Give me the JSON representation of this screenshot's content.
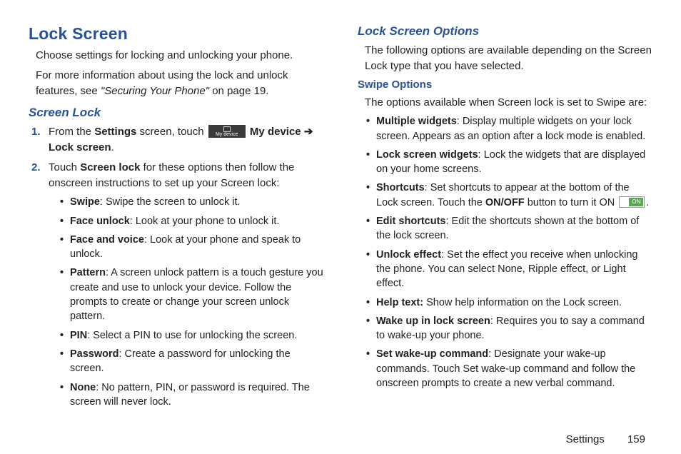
{
  "left": {
    "title": "Lock Screen",
    "p1": "Choose settings for locking and unlocking your phone.",
    "p2a": "For more information about using the lock and unlock features, see ",
    "p2_em": "\"Securing Your Phone\"",
    "p2b": " on page 19.",
    "subhead": "Screen Lock",
    "step1_a": "From the ",
    "step1_b": "Settings",
    "step1_c": " screen, touch ",
    "step1_icon_label": "My device",
    "step1_d": " My device ",
    "step1_arrow": "➔",
    "step1_e": " Lock screen",
    "step1_f": ".",
    "step2_a": "Touch ",
    "step2_b": "Screen lock",
    "step2_c": " for these options then follow the onscreen instructions to set up your Screen lock:",
    "b1t": "Swipe",
    "b1d": ": Swipe the screen to unlock it.",
    "b2t": "Face unlock",
    "b2d": ": Look at your phone to unlock it.",
    "b3t": "Face and voice",
    "b3d": ": Look at your phone and speak to unlock.",
    "b4t": "Pattern",
    "b4d": ": A screen unlock pattern is a touch gesture you create and use to unlock your device. Follow the prompts to create or change your screen unlock pattern.",
    "b5t": "PIN",
    "b5d": ": Select a PIN to use for unlocking the screen.",
    "b6t": "Password",
    "b6d": ": Create a password for unlocking the screen.",
    "b7t": "None",
    "b7d": ": No pattern, PIN, or password is required. The screen will never lock."
  },
  "right": {
    "title": "Lock Screen Options",
    "intro": "The following options are available depending on the Screen Lock type that you have selected.",
    "opthead": "Swipe Options",
    "optintro": "The options available when Screen lock is set to Swipe are:",
    "r1t": "Multiple widgets",
    "r1d": ": Display multiple widgets on your lock screen. Appears as an option after a lock mode is enabled.",
    "r2t": "Lock screen widgets",
    "r2d": ": Lock the widgets that are displayed on your home screens.",
    "r3t": "Shortcuts",
    "r3a": ": Set shortcuts to appear at the bottom of the Lock screen. Touch the ",
    "r3b": "ON/OFF",
    "r3c": " button to turn it ON ",
    "r3d": ".",
    "r4t": "Edit shortcuts",
    "r4d": ": Edit the shortcuts shown at the bottom of the lock screen.",
    "r5t": "Unlock effect",
    "r5d": ": Set the effect you receive when unlocking the phone. You can select None, Ripple effect, or Light effect.",
    "r6t": "Help text: ",
    "r6d": "Show help information on the Lock screen.",
    "r7t": "Wake up in lock screen",
    "r7d": ": Requires you to say a command to wake-up your phone.",
    "r8t": "Set wake-up command",
    "r8d": ": Designate your wake-up commands. Touch Set wake-up command and follow the onscreen prompts to create a new verbal command."
  },
  "footer": {
    "section": "Settings",
    "page": "159"
  }
}
